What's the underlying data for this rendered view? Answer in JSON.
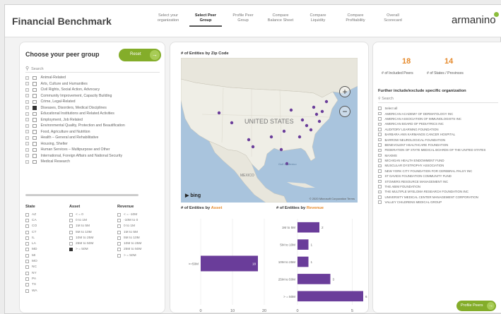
{
  "header": {
    "title": "Financial Benchmark",
    "logo_text": "armanino",
    "tabs": [
      {
        "line1": "Select your",
        "line2": "organization",
        "active": false
      },
      {
        "line1": "Select Peer",
        "line2": "Group",
        "active": true
      },
      {
        "line1": "Profile Peer",
        "line2": "Group",
        "active": false
      },
      {
        "line1": "Compare",
        "line2": "Balance Sheet",
        "active": false
      },
      {
        "line1": "Compare",
        "line2": "Liquidity",
        "active": false
      },
      {
        "line1": "Compare",
        "line2": "Profitability",
        "active": false
      },
      {
        "line1": "Overall",
        "line2": "Scorecard",
        "active": false
      }
    ]
  },
  "peer_group": {
    "title": "Choose your peer group",
    "reset_label": "Reset",
    "search_placeholder": "Search",
    "categories": [
      {
        "label": "Animal-Related",
        "checked": false
      },
      {
        "label": "Arts, Culture and Humanities",
        "checked": false
      },
      {
        "label": "Civil Rights, Social Action, Advocacy",
        "checked": false
      },
      {
        "label": "Community Improvement, Capacity Building",
        "checked": false
      },
      {
        "label": "Crime, Legal-Related",
        "checked": false
      },
      {
        "label": "Diseases, Disorders, Medical Disciplines",
        "checked": true
      },
      {
        "label": "Educational Institutions and Related Activities",
        "checked": false
      },
      {
        "label": "Employment, Job Related",
        "checked": false
      },
      {
        "label": "Environmental Quality, Protection and Beautification",
        "checked": false
      },
      {
        "label": "Food, Agriculture and Nutrition",
        "checked": false
      },
      {
        "label": "Health – General and Rehabilitative",
        "checked": false
      },
      {
        "label": "Housing, Shelter",
        "checked": false
      },
      {
        "label": "Human Services – Multipurpose and Other",
        "checked": false
      },
      {
        "label": "International, Foreign Affairs and National Security",
        "checked": false
      },
      {
        "label": "Medical Research",
        "checked": false
      }
    ]
  },
  "filters": {
    "state": {
      "header": "State",
      "items": [
        "AZ",
        "CA",
        "CO",
        "CT",
        "IL",
        "LA",
        "MD",
        "MI",
        "MO",
        "NC",
        "NY",
        "PA",
        "TX",
        "WA"
      ],
      "checked": []
    },
    "asset": {
      "header": "Asset",
      "items": [
        "< = 0",
        "0 to 1M",
        "1M to 5M",
        "5M to 10M",
        "10M to 25M",
        "25M to 50M",
        "> = 50M"
      ],
      "checked": [
        6
      ]
    },
    "revenue": {
      "header": "Revenue",
      "items": [
        "< = -10M",
        "-10M to 0",
        "0 to 1M",
        "1M to 5M",
        "5M to 10M",
        "10M to 25M",
        "25M to 50M",
        "> = 50M"
      ],
      "checked": []
    }
  },
  "map": {
    "title": "# of Entities by Zip Code",
    "country_label": "UNITED STATES",
    "mexico_label": "MEXICO",
    "gulf_label": "Gulf of Mexico",
    "provider": "bing",
    "copyright": "© 2020 Microsoft Corporation Terms",
    "zoom_in": "+",
    "zoom_out": "−",
    "points_color": "#6a3d9a"
  },
  "charts": {
    "asset_title_prefix": "# of Entities by ",
    "asset_title_accent": "Asset",
    "revenue_title_prefix": "# of Entities by ",
    "revenue_title_accent": "Revenue"
  },
  "chart_data": [
    {
      "type": "bar",
      "orientation": "horizontal",
      "title": "# of Entities by Asset",
      "categories": [
        ">=50M"
      ],
      "values": [
        18
      ],
      "xlim": [
        0,
        20
      ],
      "xticks": [
        0,
        10,
        20
      ],
      "color": "#6a3d9a"
    },
    {
      "type": "bar",
      "orientation": "horizontal",
      "title": "# of Entities by Revenue",
      "categories": [
        "1M to 5M",
        "5M to 10M",
        "10M to 25M",
        "25M to 50M",
        "> = 50M"
      ],
      "values": [
        2,
        1,
        1,
        3,
        6
      ],
      "xlim": [
        0,
        6
      ],
      "xticks": [
        0,
        5
      ],
      "color": "#6a3d9a"
    }
  ],
  "kpis": [
    {
      "value": "18",
      "label": "# of Included Peers"
    },
    {
      "value": "14",
      "label": "# of States / Provinces"
    }
  ],
  "org_filter": {
    "title": "Further include/exclude specific organization",
    "search_placeholder": "Search",
    "items": [
      "Select all",
      "AMERICAN ACADEMY OF DERMATOLOGY INC",
      "AMERICAN ASSOCIATION OF IMMUNOLOGISTS INC",
      "AMERICAN BOARD OF PEDIATRICS INC",
      "AUDITORY LEARNING FOUNDATION",
      "BARBARA ANN KARMANOS CANCER HOSPITAL",
      "BARROW NEUROLOGICAL FOUNDATION",
      "BENEVOLENT HEALTHCARE FOUNDATION",
      "FEDERATION OF STATE MEDICAL BOARDS OF THE UNITED STATES",
      "MAXIMS",
      "MICHIGAN HEALTH ENDOWMENT FUND",
      "MUSCULAR DYSTROPHY ASSOCIATION",
      "NEW YORK CITY FOUNDATION FOR CEREBRAL PALSY INC",
      "ST DAVIDS FOUNDATION COMMUNITY FUND",
      "STOWERS RESOURCE MANAGEMENT INC",
      "THE ABIM FOUNDATION",
      "THE MULTIPLE MYELOMA RESEARCH FOUNDATION INC",
      "UNIVERSITY MEDICAL CENTER MANAGEMENT CORPORATION",
      "VALLEY CHILDRENS MEDICAL GROUP"
    ]
  },
  "profile_button_label": "Profile Peers",
  "colors": {
    "accent_green": "#84ad2a",
    "accent_orange": "#e58a2c",
    "bar_purple": "#6a3d9a"
  }
}
